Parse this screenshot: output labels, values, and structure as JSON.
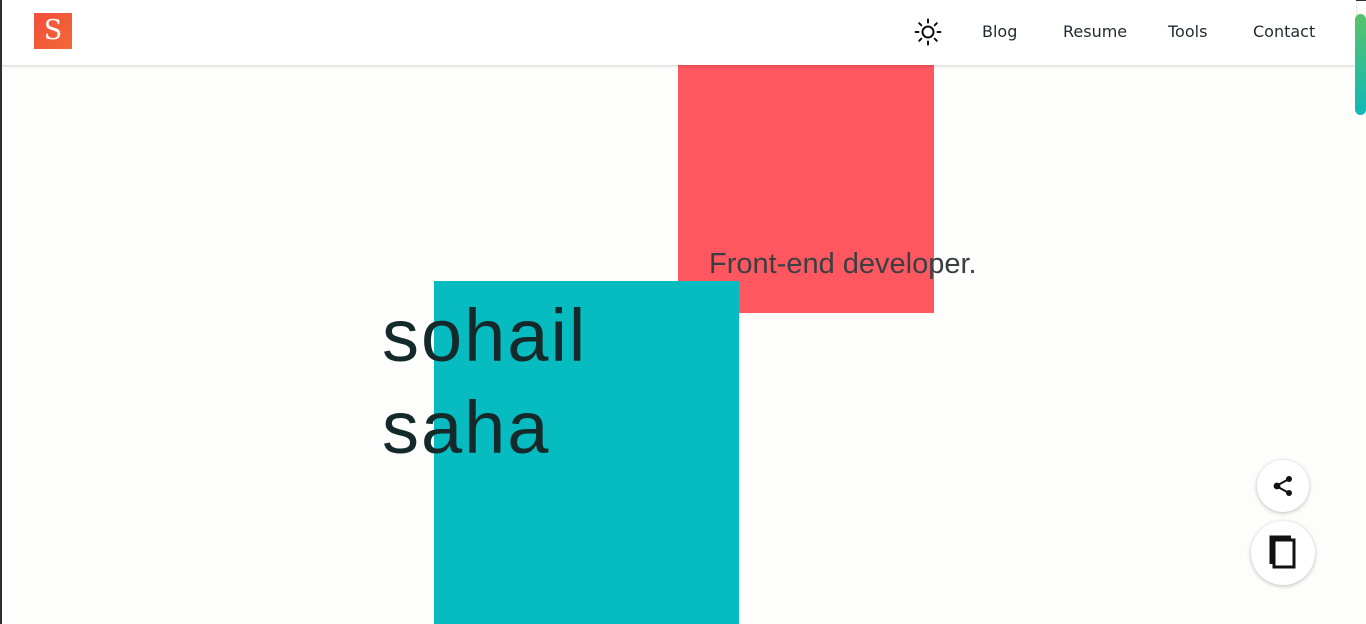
{
  "logo": {
    "letter": "S"
  },
  "nav": {
    "theme_toggle_icon": "sun-icon",
    "links": [
      {
        "label": "Blog"
      },
      {
        "label": "Resume"
      },
      {
        "label": "Tools"
      },
      {
        "label": "Contact"
      }
    ]
  },
  "hero": {
    "tagline": "Front-end developer.",
    "name_line1": "sohail",
    "name_line2": "saha"
  },
  "fabs": {
    "share_icon": "share-icon",
    "book_icon": "book-icon"
  },
  "colors": {
    "logo": "#f24d3c",
    "red_block": "#ff575f",
    "teal_block": "#06bcc1",
    "scroll_indicator_top": "#5ac36b",
    "scroll_indicator_bottom": "#0fb8b8",
    "text_dark": "#142a2a"
  }
}
